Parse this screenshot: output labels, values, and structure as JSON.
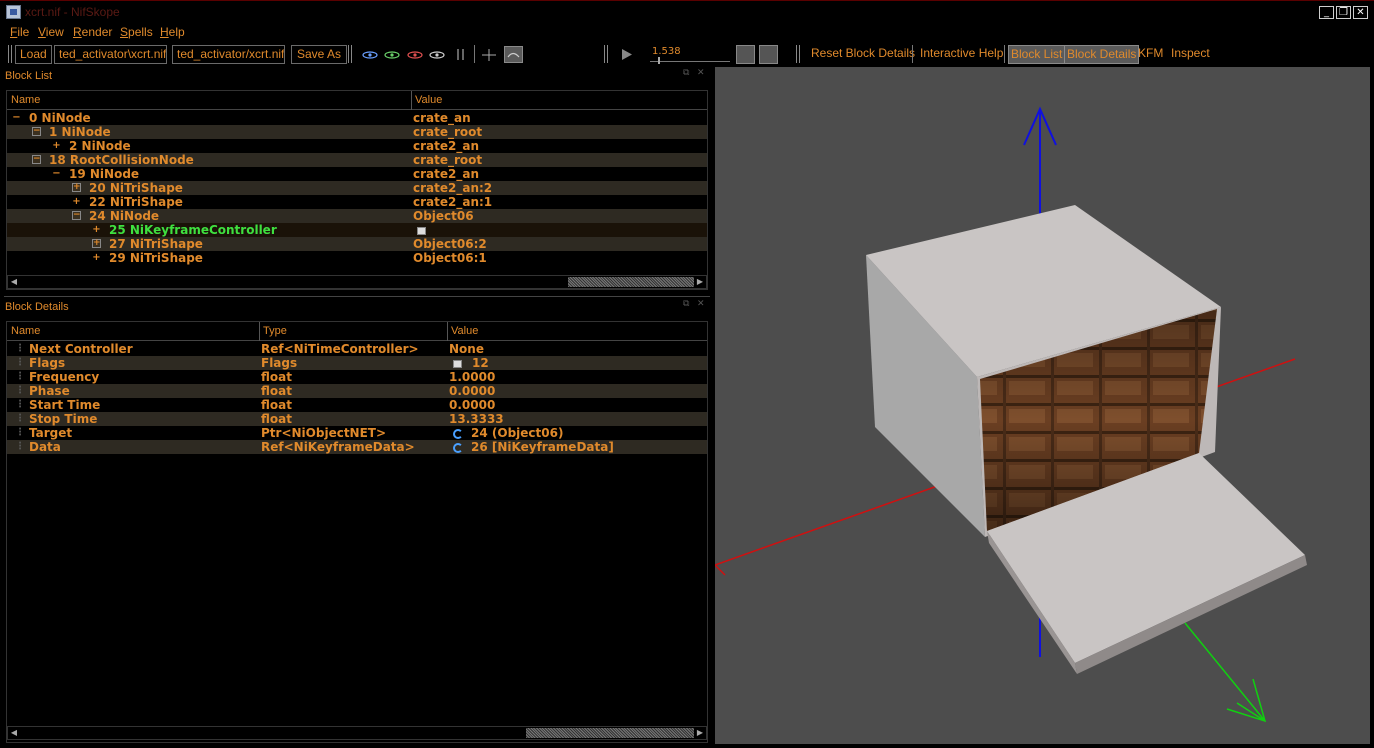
{
  "window": {
    "title": "xcrt.nif - NifSkope",
    "minimize": "_",
    "restore": "❐",
    "close": "✕"
  },
  "menu": {
    "file": {
      "u": "F",
      "rest": "ile"
    },
    "view": {
      "u": "V",
      "rest": "iew"
    },
    "render": {
      "u": "R",
      "rest": "ender"
    },
    "spells": {
      "u": "S",
      "rest": "pells"
    },
    "help": {
      "u": "H",
      "rest": "elp"
    }
  },
  "toolbar": {
    "load": "Load",
    "load_path": "ted_activator\\xcrt.nif",
    "save_path": "ted_activator/xcrt.nif",
    "save_as": "Save As",
    "anim_time": "1.538",
    "reset_block_details": "Reset Block Details",
    "interactive_help": "Interactive Help",
    "block_list": "Block List",
    "block_details": "Block Details",
    "kfm": "KFM",
    "inspect": "Inspect"
  },
  "block_list": {
    "title": "Block List",
    "col_name": "Name",
    "col_value": "Value",
    "rows": [
      {
        "exp": "−",
        "name": "0 NiNode",
        "value": "crate_an"
      },
      {
        "exp": "−",
        "name": "1 NiNode",
        "value": "crate_root"
      },
      {
        "exp": "+",
        "name": "2 NiNode",
        "value": "crate2_an"
      },
      {
        "exp": "−",
        "name": "18 RootCollisionNode",
        "value": "crate_root"
      },
      {
        "exp": "−",
        "name": "19 NiNode",
        "value": "crate2_an"
      },
      {
        "exp": "+",
        "name": "20 NiTriShape",
        "value": "crate2_an:2"
      },
      {
        "exp": "+",
        "name": "22 NiTriShape",
        "value": "crate2_an:1"
      },
      {
        "exp": "−",
        "name": "24 NiNode",
        "value": "Object06"
      },
      {
        "exp": "+",
        "name": "25 NiKeyframeController",
        "value": ""
      },
      {
        "exp": "+",
        "name": "27 NiTriShape",
        "value": "Object06:2"
      },
      {
        "exp": "+",
        "name": "29 NiTriShape",
        "value": "Object06:1"
      }
    ]
  },
  "block_details": {
    "title": "Block Details",
    "col_name": "Name",
    "col_type": "Type",
    "col_value": "Value",
    "rows": [
      {
        "name": "Next Controller",
        "type": "Ref<NiTimeController>",
        "value": "None"
      },
      {
        "name": "Flags",
        "type": "Flags",
        "value": "12"
      },
      {
        "name": "Frequency",
        "type": "float",
        "value": "1.0000"
      },
      {
        "name": "Phase",
        "type": "float",
        "value": "0.0000"
      },
      {
        "name": "Start Time",
        "type": "float",
        "value": "0.0000"
      },
      {
        "name": "Stop Time",
        "type": "float",
        "value": "13.3333"
      },
      {
        "name": "Target",
        "type": "Ptr<NiObjectNET>",
        "value": "24 (Object06)"
      },
      {
        "name": "Data",
        "type": "Ref<NiKeyframeData>",
        "value": "26 [NiKeyframeData]"
      }
    ]
  },
  "colors": {
    "text": "#e08a2c",
    "selected_text": "#3fe03f",
    "viewport_bg": "#4d4d4d",
    "axis_x": "#d01010",
    "axis_y": "#10d010",
    "axis_z": "#1010e0"
  }
}
